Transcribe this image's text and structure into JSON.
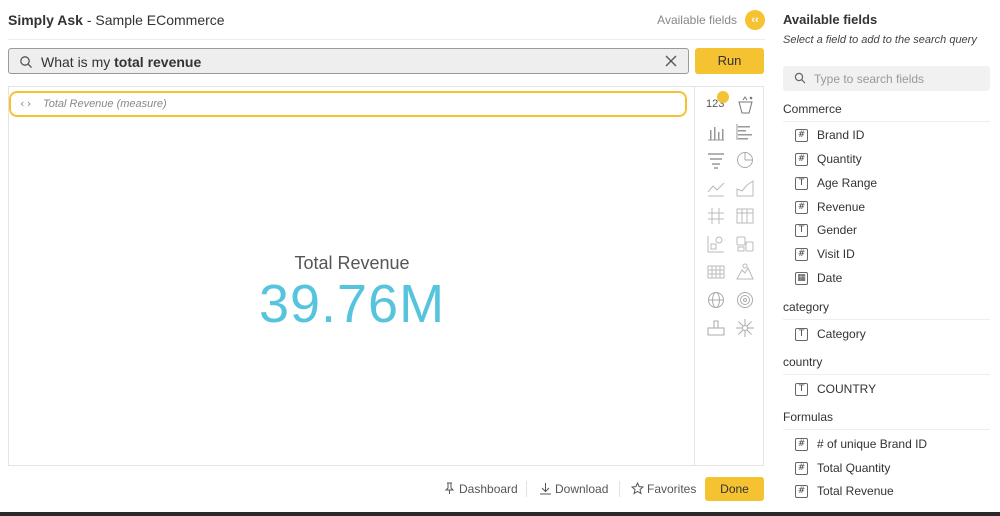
{
  "header": {
    "title_bold": "Simply Ask",
    "title_rest": " - Sample ECommerce",
    "available_fields_link": "Available fields",
    "collapse_icon_glyph": "‹‹"
  },
  "search": {
    "query_prefix": "What is my ",
    "query_bold": "total revenue",
    "run_label": "Run"
  },
  "result": {
    "pill_code": "‹›",
    "pill_text": "Total Revenue (measure)",
    "kpi_label": "Total Revenue",
    "kpi_value": "39.76M"
  },
  "chart_types": {
    "selected_label": "123",
    "icons": [
      "number-icon",
      "bar-chart-icon",
      "horizontal-bar-icon",
      "funnel-icon",
      "pie-chart-icon",
      "line-chart-icon",
      "area-chart-icon",
      "pivot-grid-icon",
      "table-icon",
      "scatter-icon",
      "boxes-icon",
      "heatmap-icon",
      "map-icon",
      "globe-icon",
      "target-icon",
      "indicator-icon",
      "sunburst-icon"
    ]
  },
  "footer": {
    "dashboard_label": "Dashboard",
    "download_label": "Download",
    "favorites_label": "Favorites",
    "done_label": "Done"
  },
  "panel": {
    "title": "Available fields",
    "subtitle": "Select a field to add to the search query",
    "search_placeholder": "Type to search fields",
    "groups": [
      {
        "name": "Commerce",
        "fields": [
          {
            "icon": "#",
            "label": "Brand ID"
          },
          {
            "icon": "#",
            "label": "Quantity"
          },
          {
            "icon": "T",
            "label": "Age Range"
          },
          {
            "icon": "#",
            "label": "Revenue"
          },
          {
            "icon": "T",
            "label": "Gender"
          },
          {
            "icon": "#",
            "label": "Visit ID"
          },
          {
            "icon": "▦",
            "label": "Date"
          }
        ]
      },
      {
        "name": "category",
        "fields": [
          {
            "icon": "T",
            "label": "Category"
          }
        ]
      },
      {
        "name": "country",
        "fields": [
          {
            "icon": "T",
            "label": "COUNTRY"
          }
        ]
      },
      {
        "name": "Formulas",
        "fields": [
          {
            "icon": "#",
            "label": "# of unique Brand ID"
          },
          {
            "icon": "#",
            "label": "Total Quantity"
          },
          {
            "icon": "#",
            "label": "Total Revenue"
          }
        ]
      }
    ]
  },
  "colors": {
    "accent": "#f5c232",
    "kpi": "#55c4dc"
  }
}
